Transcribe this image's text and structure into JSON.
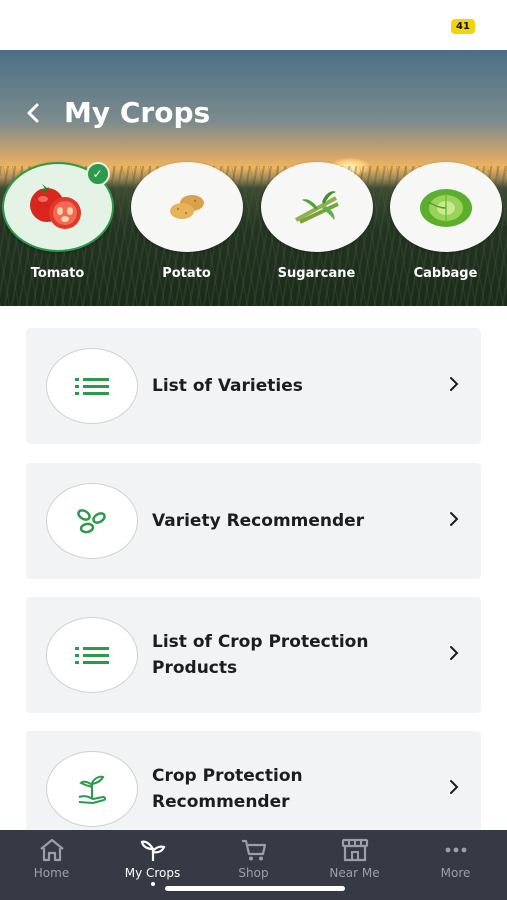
{
  "status_bar": {
    "battery": "41"
  },
  "header": {
    "title": "My Crops",
    "back_icon": "chevron-left-icon"
  },
  "crops": [
    {
      "label": "Tomato",
      "selected": true,
      "icon": "tomato-icon"
    },
    {
      "label": "Potato",
      "selected": false,
      "icon": "potato-icon"
    },
    {
      "label": "Sugarcane",
      "selected": false,
      "icon": "sugarcane-icon"
    },
    {
      "label": "Cabbage",
      "selected": false,
      "icon": "cabbage-icon"
    }
  ],
  "menu": [
    {
      "label": "List of Varieties",
      "icon": "list-icon"
    },
    {
      "label": "Variety Recommender",
      "icon": "seeds-icon"
    },
    {
      "label": "List of Crop Protection Products",
      "icon": "list-icon"
    },
    {
      "label": "Crop Protection Recommender",
      "icon": "plant-in-hand-icon"
    }
  ],
  "bottom_nav": [
    {
      "label": "Home",
      "icon": "home-icon",
      "active": false
    },
    {
      "label": "My Crops",
      "icon": "sprout-icon",
      "active": true
    },
    {
      "label": "Shop",
      "icon": "cart-icon",
      "active": false
    },
    {
      "label": "Near Me",
      "icon": "store-icon",
      "active": false
    },
    {
      "label": "More",
      "icon": "more-icon",
      "active": false
    }
  ],
  "colors": {
    "accent": "#2d9a4b",
    "nav_bg": "#353a44",
    "card_bg": "#f2f3f5"
  }
}
